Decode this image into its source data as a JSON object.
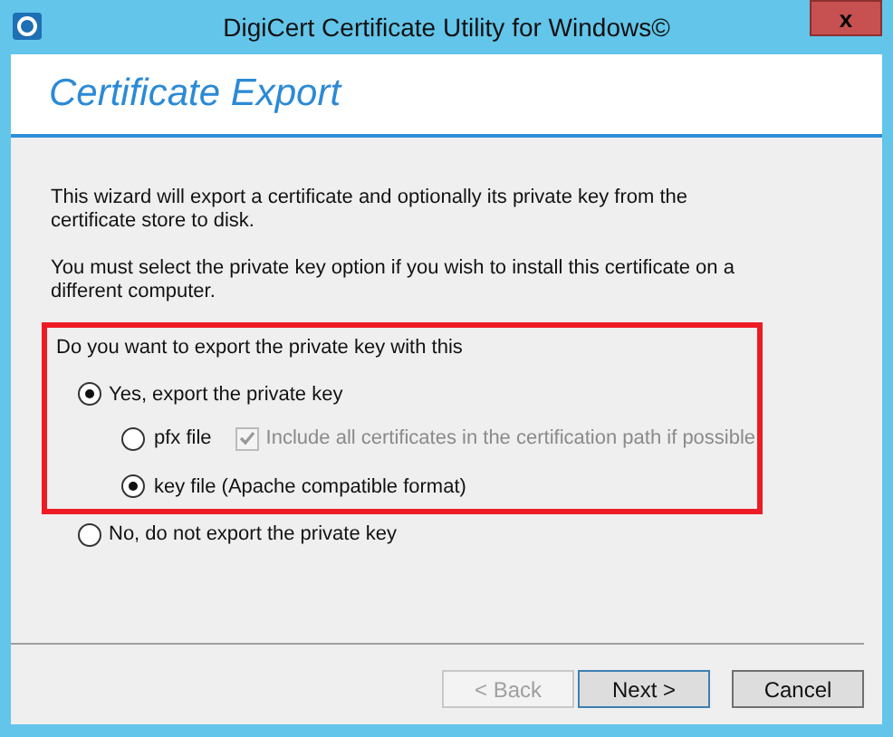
{
  "window": {
    "title": "DigiCert Certificate Utility for Windows©",
    "close": "x"
  },
  "header": {
    "title": "Certificate Export"
  },
  "intro": [
    "This wizard will export a certificate and optionally its private key from the certificate store to disk.",
    "You must select the private key option if you wish to install this certificate on a different computer."
  ],
  "export_group": {
    "highlighted": true,
    "question": "Do you want to export the private key with this",
    "yes": {
      "label": "Yes, export the private key",
      "selected": true
    },
    "formats": [
      {
        "label": "pfx file",
        "selected": false,
        "option": {
          "label": "Include all certificates in the certification path if possible",
          "checked": true,
          "disabled": true
        }
      },
      {
        "label": "key file (Apache compatible format)",
        "selected": true
      }
    ]
  },
  "no": {
    "label": "No, do not export the private key",
    "selected": false
  },
  "buttons": [
    {
      "label": "< Back",
      "disabled": true,
      "default": false
    },
    {
      "label": "Next >",
      "disabled": false,
      "default": true
    },
    {
      "label": "Cancel",
      "disabled": false,
      "default": false
    }
  ]
}
